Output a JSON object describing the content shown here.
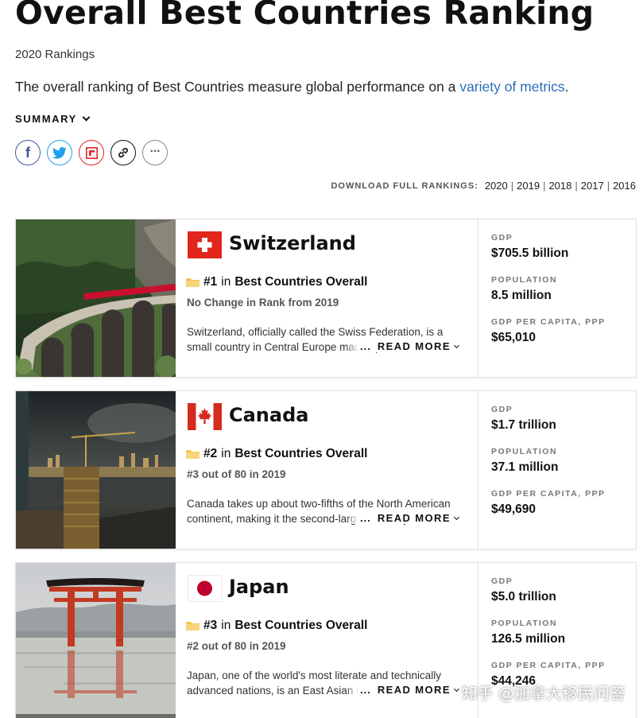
{
  "header": {
    "title": "Overall Best Countries Ranking",
    "subtitle": "2020 Rankings",
    "intro_text": "The overall ranking of Best Countries measure global performance on a ",
    "intro_link": "variety of metrics",
    "intro_end": ".",
    "summary_label": "SUMMARY"
  },
  "share": {
    "facebook": "f",
    "more": "···"
  },
  "downloads": {
    "label": "DOWNLOAD FULL RANKINGS:",
    "years": [
      "2020",
      "2019",
      "2018",
      "2017",
      "2016"
    ],
    "separator": "|"
  },
  "cards": [
    {
      "country": "Switzerland",
      "rank": "#1",
      "in_word": "in",
      "category": "Best Countries Overall",
      "change": "No Change in Rank from 2019",
      "description": "Switzerland, officially called the Swiss Federation, is a small country in Central Europe made up of",
      "read_more": "READ MORE",
      "dots": "...",
      "stats": [
        {
          "label": "GDP",
          "value": "$705.5 billion"
        },
        {
          "label": "POPULATION",
          "value": "8.5 million"
        },
        {
          "label": "GDP PER CAPITA, PPP",
          "value": "$65,010"
        }
      ]
    },
    {
      "country": "Canada",
      "rank": "#2",
      "in_word": "in",
      "category": "Best Countries Overall",
      "change": "#3 out of 80 in 2019",
      "description": "Canada takes up about two-fifths of the North American continent, making it the second-largest country",
      "read_more": "READ MORE",
      "dots": "...",
      "stats": [
        {
          "label": "GDP",
          "value": "$1.7 trillion"
        },
        {
          "label": "POPULATION",
          "value": "37.1 million"
        },
        {
          "label": "GDP PER CAPITA, PPP",
          "value": "$49,690"
        }
      ]
    },
    {
      "country": "Japan",
      "rank": "#3",
      "in_word": "in",
      "category": "Best Countries Overall",
      "change": "#2 out of 80 in 2019",
      "description": "Japan, one of the world's most literate and technically advanced nations, is an East Asian island",
      "read_more": "READ MORE",
      "dots": "...",
      "stats": [
        {
          "label": "GDP",
          "value": "$5.0 trillion"
        },
        {
          "label": "POPULATION",
          "value": "126.5 million"
        },
        {
          "label": "GDP PER CAPITA, PPP",
          "value": "$44,246"
        }
      ]
    }
  ],
  "watermark": "知乎 @加拿大移民问答",
  "colors": {
    "link": "#2a6ebb",
    "swiss_red": "#e1261c",
    "canada_red": "#d52b1e",
    "japan_red": "#bc002d",
    "trophy": "#f5c451"
  }
}
